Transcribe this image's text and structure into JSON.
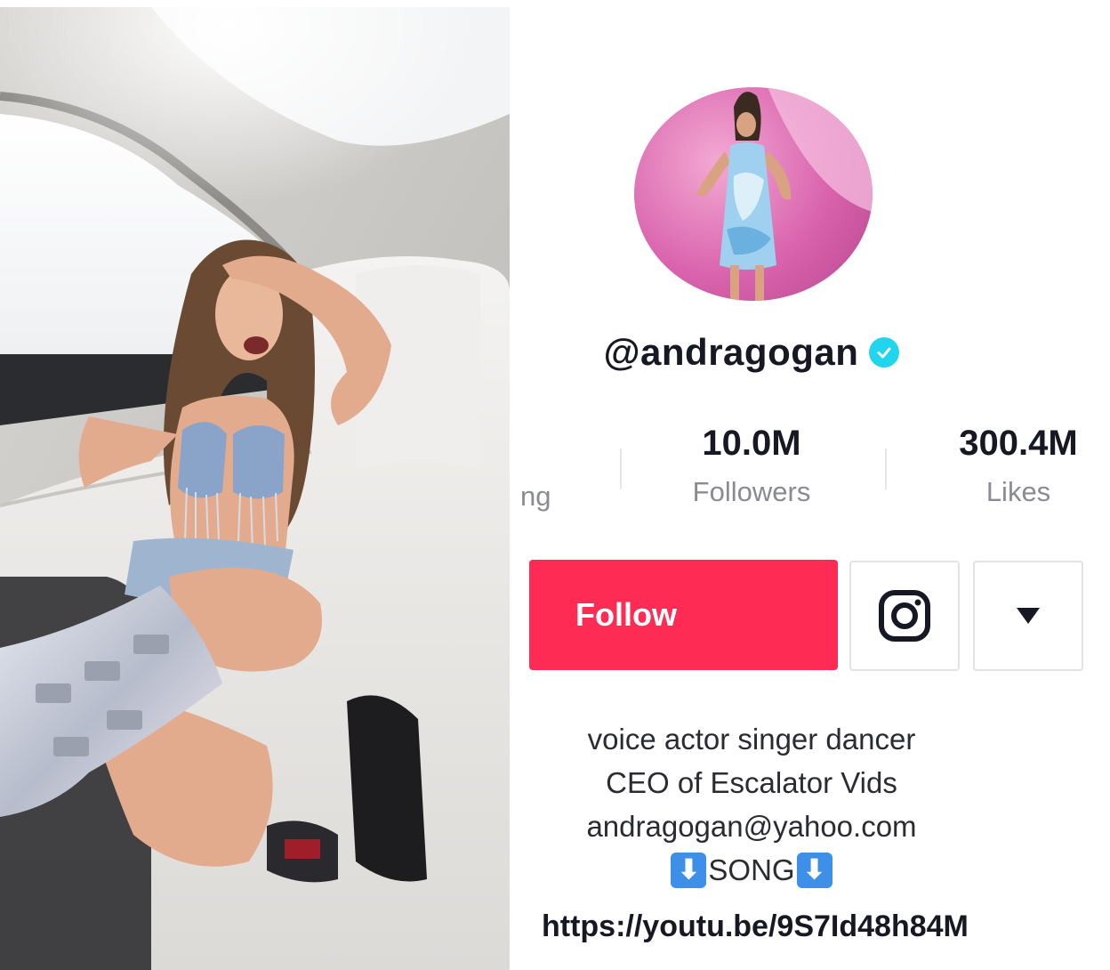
{
  "profile": {
    "username": "@andragogan",
    "stats": {
      "following_label_partial": "ng",
      "followers_value": "10.0M",
      "followers_label": "Followers",
      "likes_value": "300.4M",
      "likes_label": "Likes"
    },
    "follow_label": "Follow",
    "bio": {
      "line1": "voice actor singer dancer",
      "line2": "CEO of Escalator Vids",
      "line3": "andragogan@yahoo.com",
      "line4": "SONG",
      "arrow": "⬇",
      "link": "https://youtu.be/9S7Id48h84M"
    }
  },
  "icons": {
    "verified": "verified-badge-icon",
    "instagram": "instagram-icon",
    "more": "triangle-down-icon",
    "arrow": "down-arrow-emoji-icon"
  },
  "colors": {
    "accent": "#fe2c55",
    "verified": "#20d5ec",
    "muted_text": "#8a8b91"
  }
}
